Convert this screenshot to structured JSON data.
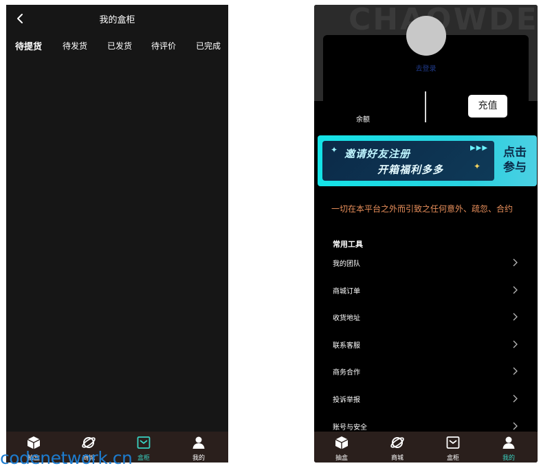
{
  "left": {
    "header": {
      "title": "我的盒柜",
      "back_icon": "chevron-left-icon"
    },
    "tabs": [
      {
        "label": "待提货",
        "active": true
      },
      {
        "label": "待发货",
        "active": false
      },
      {
        "label": "已发货",
        "active": false
      },
      {
        "label": "待评价",
        "active": false
      },
      {
        "label": "已完成",
        "active": false
      }
    ],
    "tabbar": [
      {
        "label": "抽盒",
        "icon": "box-icon",
        "active": false
      },
      {
        "label": "商城",
        "icon": "planet-icon",
        "active": false
      },
      {
        "label": "盒柜",
        "icon": "cabinet-icon",
        "active": true
      },
      {
        "label": "我的",
        "icon": "user-icon",
        "active": false
      }
    ]
  },
  "right": {
    "hero": {
      "background_text": "CHAOWDE"
    },
    "profile": {
      "login_label": "去登录",
      "balance_label": "余额",
      "recharge_label": "充值"
    },
    "banner": {
      "line1": "邀请好友注册",
      "line2": "开箱福利多多",
      "cta_line1": "点击",
      "cta_line2": "参与"
    },
    "notice": "一切在本平台之外而引致之任何意外、疏忽、合约",
    "tools": {
      "title": "常用工具",
      "items": [
        {
          "label": "我的团队"
        },
        {
          "label": "商城订单"
        },
        {
          "label": "收货地址"
        },
        {
          "label": "联系客服"
        },
        {
          "label": "商务合作"
        },
        {
          "label": "投诉举报"
        },
        {
          "label": "账号与安全"
        }
      ]
    },
    "tabbar": [
      {
        "label": "抽盒",
        "icon": "box-icon",
        "active": false
      },
      {
        "label": "商城",
        "icon": "planet-icon",
        "active": false
      },
      {
        "label": "盒柜",
        "icon": "cabinet-icon",
        "active": false
      },
      {
        "label": "我的",
        "icon": "user-icon",
        "active": true
      }
    ]
  },
  "watermark": "codenetwork.cn",
  "colors": {
    "accent": "#39d3c3",
    "notice": "#e98f5b",
    "tabbar_bg": "#2a1f1c"
  }
}
